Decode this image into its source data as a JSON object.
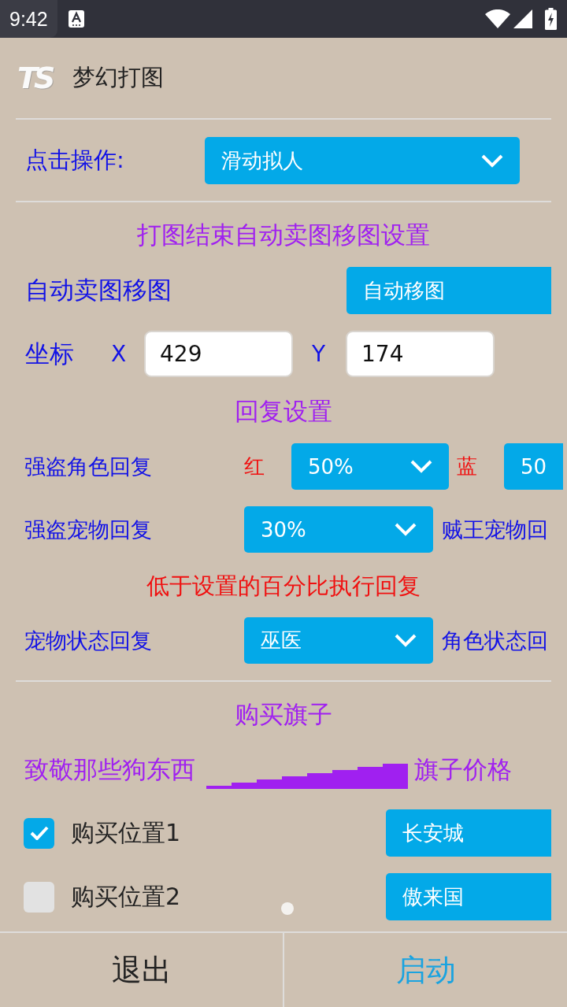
{
  "status_bar": {
    "time": "9:42"
  },
  "header": {
    "logo": "TS",
    "title": "梦幻打图"
  },
  "click_action": {
    "label": "点击操作:",
    "dropdown": "滑动拟人"
  },
  "auto_sell": {
    "title": "打图结束自动卖图移图设置",
    "label": "自动卖图移图",
    "mode": "自动移图",
    "coordinates": {
      "label": "坐标",
      "fields": [
        {
          "axis": "X",
          "value": "429"
        },
        {
          "axis": "Y",
          "value": "174"
        }
      ]
    }
  },
  "recovery": {
    "title": "回复设置",
    "items": [
      {
        "kind": "pair",
        "label": "强盗角色回复",
        "choices": [
          {
            "tag": "红",
            "value": "50%"
          },
          {
            "tag": "蓝",
            "value": "50"
          }
        ]
      },
      {
        "kind": "select",
        "label": "强盗宠物回复",
        "value": "30%",
        "next_label": "贼王宠物回"
      },
      {
        "kind": "note",
        "text": "低于设置的百分比执行回复"
      },
      {
        "kind": "select",
        "label": "宠物状态回复",
        "value": "巫医",
        "next_label": "角色状态回"
      }
    ]
  },
  "flags": {
    "title": "购买旗子",
    "price": {
      "label": "致敬那些狗东西",
      "suffix": "旗子价格"
    },
    "positions": [
      {
        "label": "购买位置1",
        "checked": true,
        "city": "长安城"
      },
      {
        "label": "购买位置2",
        "checked": false,
        "city": "傲来国"
      }
    ]
  },
  "footer": {
    "buttons": [
      {
        "label": "退出",
        "kind": "exit"
      },
      {
        "label": "启动",
        "kind": "start"
      }
    ]
  }
}
